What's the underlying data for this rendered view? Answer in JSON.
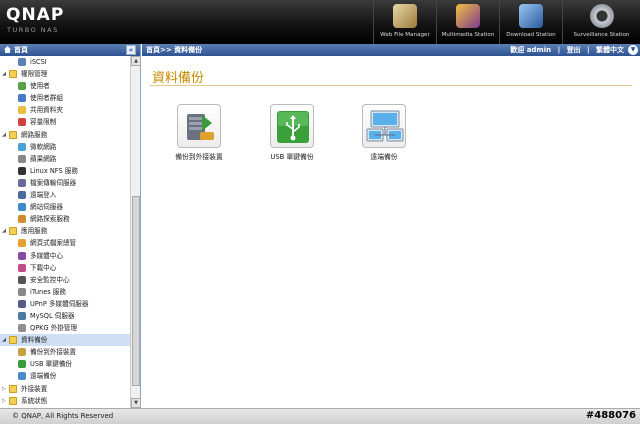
{
  "header": {
    "logo": "QNAP",
    "subtitle": "TURBO NAS",
    "apps": [
      {
        "label": "Web File Manager",
        "color": "#c79b4a"
      },
      {
        "label": "Multimedia Station",
        "color": "#7f3a8d"
      },
      {
        "label": "Download Station",
        "color": "#4a7fcf"
      },
      {
        "label": "Surveillance Station",
        "color": "#9aa0a8"
      }
    ]
  },
  "sidebar": {
    "title": "首頁",
    "collapse": "«",
    "items": [
      {
        "label": "iSCSI",
        "level": 1,
        "icon": "#5a7fb0"
      },
      {
        "label": "權限管理",
        "level": 0,
        "folder": true,
        "open": true
      },
      {
        "label": "使用者",
        "level": 1,
        "icon": "#5aa04a"
      },
      {
        "label": "使用者群組",
        "level": 1,
        "icon": "#4a78c8"
      },
      {
        "label": "共用資料夾",
        "level": 1,
        "icon": "#e8c040"
      },
      {
        "label": "容量限制",
        "level": 1,
        "icon": "#d04040"
      },
      {
        "label": "網路服務",
        "level": 0,
        "folder": true,
        "open": true
      },
      {
        "label": "微軟網路",
        "level": 1,
        "icon": "#4aa0d8"
      },
      {
        "label": "蘋果網路",
        "level": 1,
        "icon": "#888888"
      },
      {
        "label": "Linux NFS 服務",
        "level": 1,
        "icon": "#333333"
      },
      {
        "label": "檔案傳輸伺服器",
        "level": 1,
        "icon": "#6a6a9a"
      },
      {
        "label": "遠端登入",
        "level": 1,
        "icon": "#4a6aa0"
      },
      {
        "label": "網站伺服器",
        "level": 1,
        "icon": "#3a8ad0"
      },
      {
        "label": "網路探索服務",
        "level": 1,
        "icon": "#d08a30"
      },
      {
        "label": "應用服務",
        "level": 0,
        "folder": true,
        "open": true
      },
      {
        "label": "網頁式檔案總管",
        "level": 1,
        "icon": "#e8a030"
      },
      {
        "label": "多媒體中心",
        "level": 1,
        "icon": "#8a4aa0"
      },
      {
        "label": "下載中心",
        "level": 1,
        "icon": "#c04a8a"
      },
      {
        "label": "安全監控中心",
        "level": 1,
        "icon": "#555555"
      },
      {
        "label": "iTunes 服務",
        "level": 1,
        "icon": "#888888"
      },
      {
        "label": "UPnP 多媒體伺服器",
        "level": 1,
        "icon": "#5a5a8a"
      },
      {
        "label": "MySQL 伺服器",
        "level": 1,
        "icon": "#4a7aa0"
      },
      {
        "label": "QPKG 外掛管理",
        "level": 1,
        "icon": "#909090"
      },
      {
        "label": "資料備份",
        "level": 0,
        "folder": true,
        "open": true,
        "selected": true
      },
      {
        "label": "備份到外接裝置",
        "level": 1,
        "icon": "#c8a040"
      },
      {
        "label": "USB 單鍵備份",
        "level": 1,
        "icon": "#3a9a3a"
      },
      {
        "label": "遠端備份",
        "level": 1,
        "icon": "#4a8ac8"
      },
      {
        "label": "外接裝置",
        "level": 0,
        "folder": true,
        "open": false
      },
      {
        "label": "系統狀態",
        "level": 0,
        "folder": true,
        "open": false
      }
    ]
  },
  "main": {
    "breadcrumb": "首頁>> 資料備份",
    "welcome": "歡迎 admin",
    "separator": "|",
    "logout": "登出",
    "language": "繁體中文",
    "page_title": "資料備份",
    "functions": [
      {
        "label": "備份到外接裝置",
        "icon": "backup-to-external-icon"
      },
      {
        "label": "USB 單鍵備份",
        "icon": "usb-backup-icon"
      },
      {
        "label": "遠端備份",
        "icon": "remote-backup-icon"
      }
    ]
  },
  "footer": {
    "copyright": "© QNAP, All Rights Reserved",
    "post_id": "#488076"
  }
}
